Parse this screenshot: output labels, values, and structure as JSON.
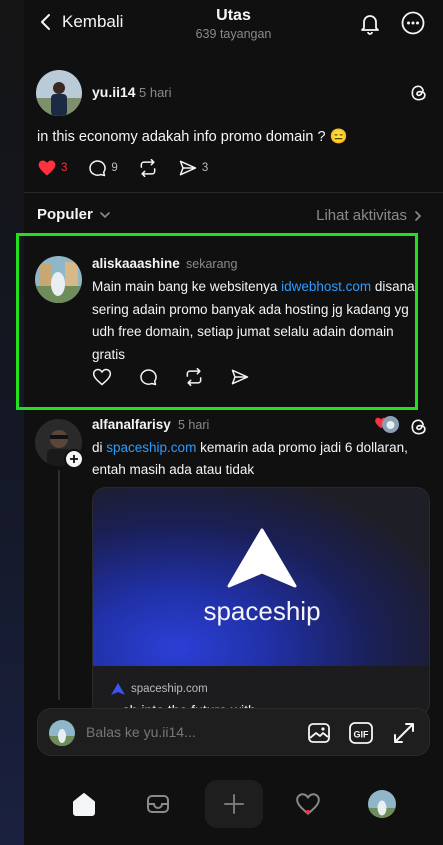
{
  "header": {
    "back_label": "Kembali",
    "title": "Utas",
    "subtitle": "639 tayangan"
  },
  "post": {
    "username": "yu.ii14",
    "time": "5 hari",
    "text": "in this economy adakah info promo domain ? 😑",
    "likes": "3",
    "replies": "9",
    "shares": "3"
  },
  "sort": {
    "label": "Populer",
    "activity_link": "Lihat aktivitas"
  },
  "reply1": {
    "username": "aliskaaashine",
    "time": "sekarang",
    "text_before": "Main main bang ke websitenya ",
    "link": "idwebhost.com",
    "text_after": " disana sering adain promo banyak ada hosting jg kadang yg udh free domain, setiap jumat selalu adain domain gratis"
  },
  "reply2": {
    "username": "alfanalfarisy",
    "time": "5 hari",
    "text_before": "di ",
    "link": "spaceship.com",
    "text_after": " kemarin ada promo jadi 6 dollaran, entah masih ada atau tidak",
    "card": {
      "brand": "spaceship",
      "domain": "spaceship.com",
      "title_partial": "...sh into the future with..."
    }
  },
  "reply_box": {
    "placeholder": "Balas ke yu.ii14..."
  },
  "icons": {
    "back": "chevron-left-icon",
    "notifications": "bell-icon",
    "more": "more-icon",
    "threads": "threads-logo-icon",
    "like": "heart-icon",
    "comment": "comment-icon",
    "repost": "repost-icon",
    "share": "send-icon",
    "gallery": "image-icon",
    "gif": "gif-icon",
    "expand": "expand-icon",
    "home": "home-icon",
    "inbox": "inbox-icon",
    "create": "plus-icon",
    "activity": "heart-icon",
    "profile": "avatar"
  },
  "colors": {
    "background": "#101010",
    "highlight_border": "#22e01c",
    "link": "#2d9cff",
    "like_active": "#ff3040",
    "muted_text": "#8a8a8a"
  }
}
